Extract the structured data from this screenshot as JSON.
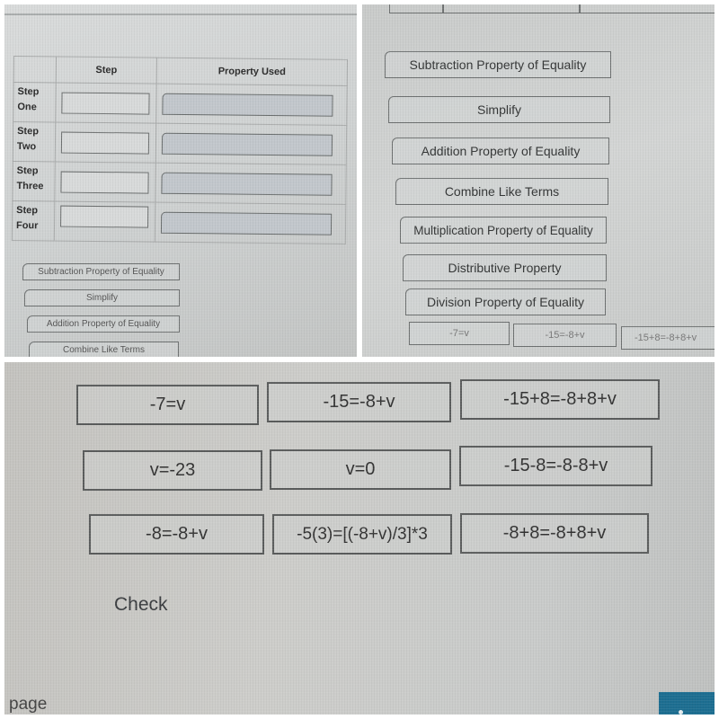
{
  "table": {
    "headers": [
      "",
      "Step",
      "Property Used"
    ],
    "rows": [
      {
        "label_line1": "Step",
        "label_line2": "One",
        "step_value": "",
        "property_value": ""
      },
      {
        "label_line1": "Step",
        "label_line2": "Two",
        "step_value": "",
        "property_value": ""
      },
      {
        "label_line1": "Step",
        "label_line2": "Three",
        "step_value": "",
        "property_value": ""
      },
      {
        "label_line1": "Step",
        "label_line2": "Four",
        "step_value": "",
        "property_value": ""
      }
    ]
  },
  "properties": [
    "Subtraction Property of Equality",
    "Simplify",
    "Addition Property of Equality",
    "Combine Like Terms",
    "Multiplication Property of Equality",
    "Distributive Property",
    "Division Property of Equality"
  ],
  "equations": [
    "-7=v",
    "-15=-8+v",
    "-15+8=-8+8+v",
    "v=-23",
    "v=0",
    "-15-8=-8-8+v",
    "-8=-8+v",
    "-5(3)=[(-8+v)/3]*3",
    "-8+8=-8+8+v"
  ],
  "actions": {
    "check_label": "Check"
  },
  "footer": {
    "page_label": "page"
  },
  "colors": {
    "button_accent": "#1d6e91"
  }
}
